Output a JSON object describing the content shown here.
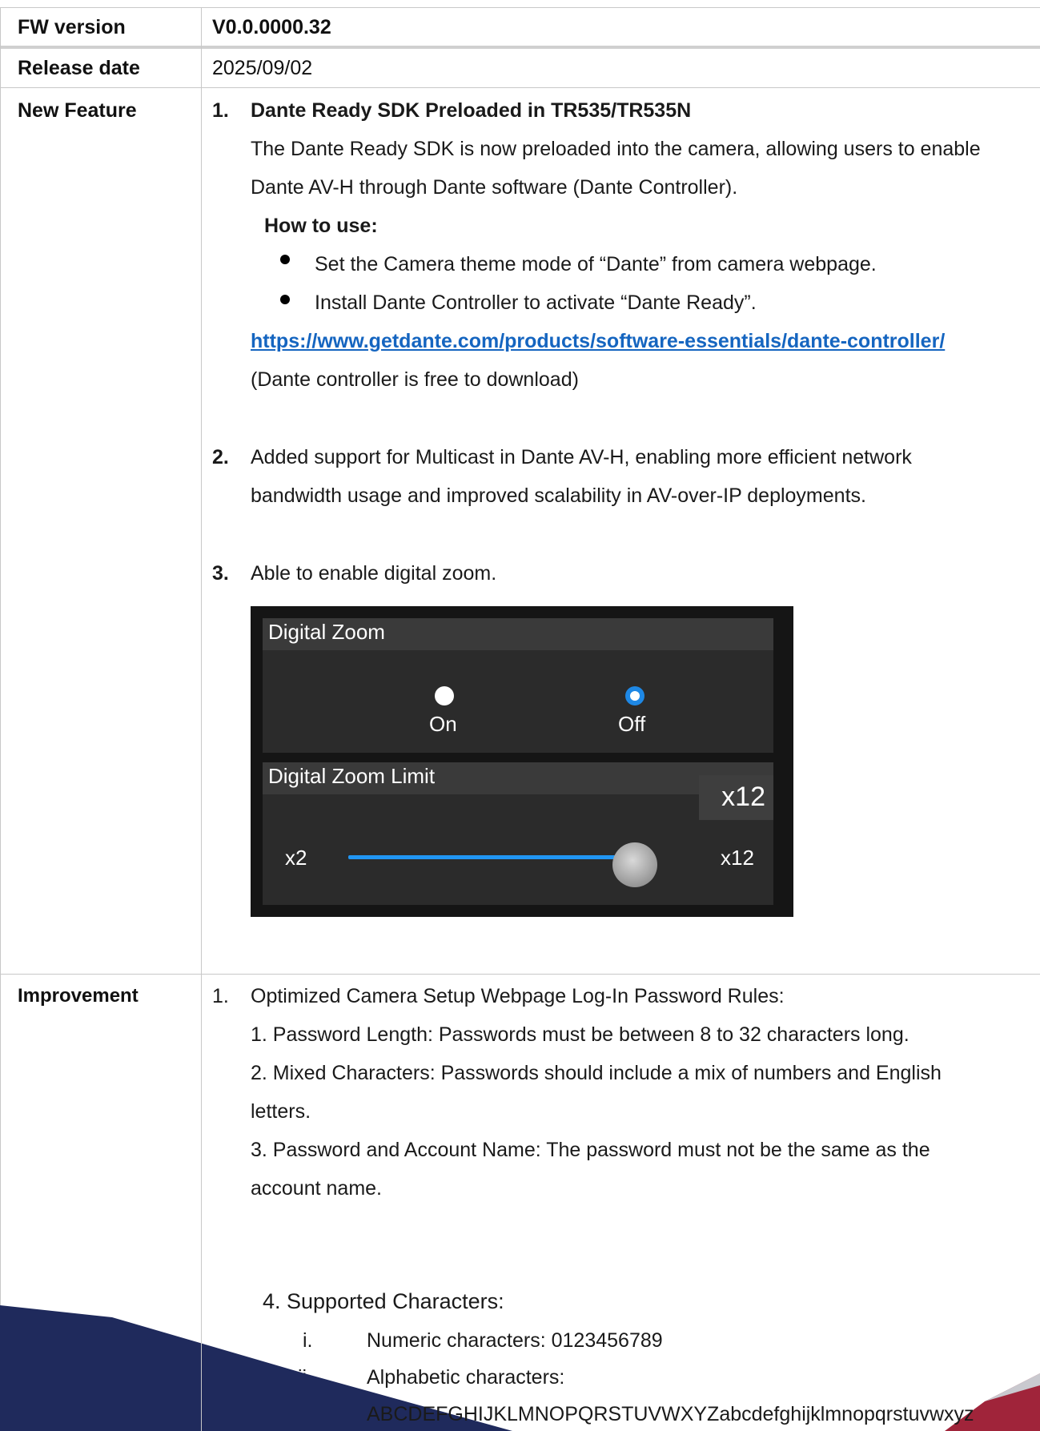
{
  "header": {
    "fw_label": "FW version",
    "fw_value": "V0.0.0000.32",
    "date_label": "Release date",
    "date_value": "2025/09/02"
  },
  "new_feature": {
    "label": "New Feature",
    "item1": {
      "num": "1.",
      "title": "Dante Ready SDK Preloaded in TR535/TR535N",
      "line1": "The Dante Ready SDK is now preloaded into the camera, allowing users to enable",
      "line2": "Dante AV-H through Dante software (Dante Controller).",
      "how_to": "How to use:",
      "bullet1": "Set the Camera theme mode of “Dante” from camera webpage.",
      "bullet2": "Install Dante Controller to activate “Dante Ready”.",
      "link": "https://www.getdante.com/products/software-essentials/dante-controller/",
      "note": "(Dante controller is free to download)"
    },
    "item2": {
      "num": "2.",
      "line1": "Added support for Multicast in Dante AV-H, enabling more efficient network",
      "line2": "bandwidth usage and improved scalability in AV-over-IP deployments."
    },
    "item3": {
      "num": "3.",
      "text": "Able to enable digital zoom."
    },
    "digital_zoom": {
      "title": "Digital Zoom",
      "option_on": "On",
      "option_off": "Off",
      "selected": "Off",
      "limit_title": "Digital Zoom Limit",
      "limit_value": "x12",
      "min_label": "x2",
      "max_label": "x12",
      "slider_fraction": 1.0
    }
  },
  "improvement": {
    "label": "Improvement",
    "num": "1.",
    "title": "Optimized Camera Setup Webpage Log-In Password Rules:",
    "rule1": "1. Password Length: Passwords must be between 8 to 32 characters long.",
    "rule2a": "2. Mixed Characters: Passwords should include a mix of numbers and English",
    "rule2b": "letters.",
    "rule3a": "3. Password and Account Name: The password must not be the same as the",
    "rule3b": "account name.",
    "rule4": "4. Supported Characters:",
    "sub_i_num": "i.",
    "sub_i": "Numeric characters: 0123456789",
    "sub_ii_num": "ii.",
    "sub_ii": "Alphabetic characters:",
    "alphabet": "ABCDEFGHIJKLMNOPQRSTUVWXYZabcdefghijklmnopqrstuvwxyz"
  },
  "colors": {
    "link": "#1565c0",
    "radio_selected": "#1e88e5",
    "slider_track": "#2196f3",
    "footer_navy": "#1f2a5c",
    "footer_red": "#a0243a"
  }
}
